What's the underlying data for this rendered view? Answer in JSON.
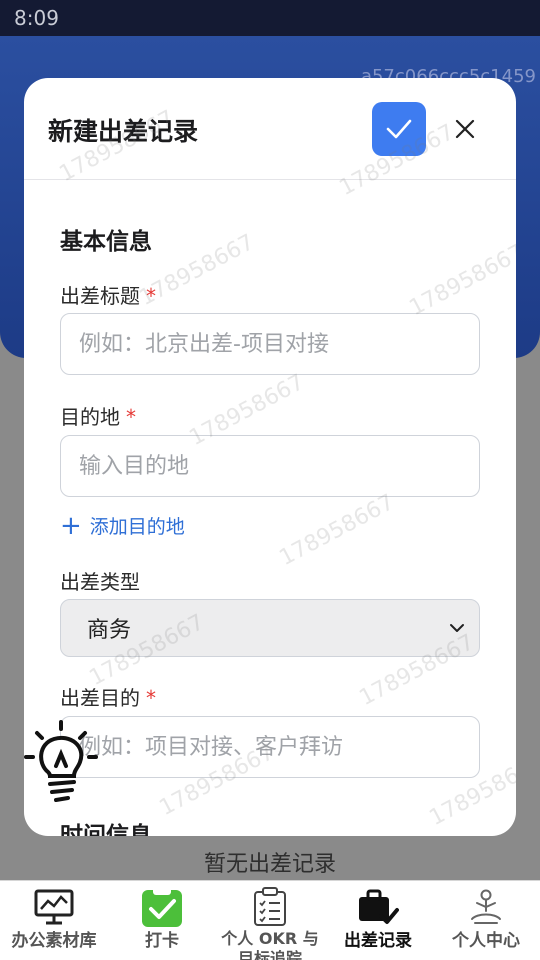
{
  "background": {
    "status_time": "8:09",
    "hash_text": "a57c066ccc5c1459",
    "empty_text": "暂无出差记录"
  },
  "modal": {
    "title": "新建出差记录",
    "confirm_icon": "check-icon",
    "close_icon": "close-icon",
    "sections": {
      "basic_title": "基本信息",
      "time_title": "时间信息"
    },
    "fields": {
      "title": {
        "label": "出差标题",
        "required_mark": "*",
        "placeholder": "例如：北京出差-项目对接",
        "value": ""
      },
      "destination": {
        "label": "目的地",
        "required_mark": "*",
        "placeholder": "输入目的地",
        "value": ""
      },
      "add_destination": "添加目的地",
      "type": {
        "label": "出差类型",
        "selected": "商务"
      },
      "purpose": {
        "label": "出差目的",
        "required_mark": "*",
        "placeholder": "例如：项目对接、客户拜访",
        "value": ""
      }
    }
  },
  "watermark_text": "178958667",
  "bottom_nav": [
    {
      "label": "办公素材库",
      "icon": "chart-monitor-icon"
    },
    {
      "label": "打卡",
      "icon": "clipboard-check-icon"
    },
    {
      "label": "个人 OKR 与目标追踪",
      "icon": "checklist-icon"
    },
    {
      "label": "出差记录",
      "icon": "briefcase-icon"
    },
    {
      "label": "个人中心",
      "icon": "meditation-icon"
    }
  ],
  "colors": {
    "accent": "#3e7cf0",
    "banner": "#1d3b86",
    "required": "#e53935",
    "link": "#2f6fd6",
    "active_icon_bg": "#4cbf3a"
  }
}
